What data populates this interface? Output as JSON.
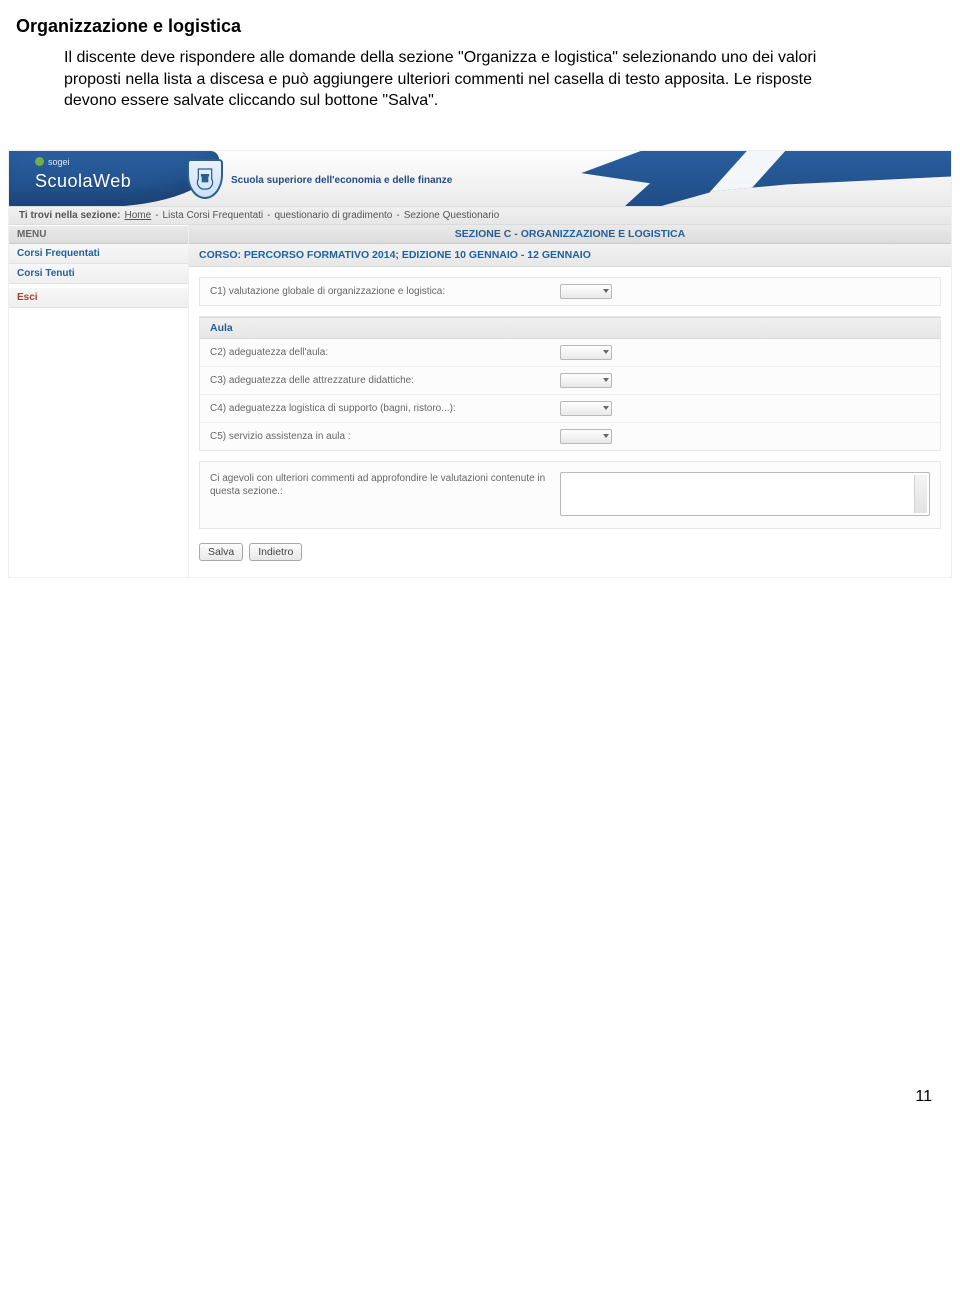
{
  "document": {
    "title": "Organizzazione e logistica",
    "paragraph": "Il discente deve rispondere alle domande della sezione \"Organizza e logistica\" selezionando uno dei valori proposti nella lista a discesa e può aggiungere ulteriori commenti nel casella di testo apposita.\nLe risposte devono essere salvate cliccando sul bottone \"Salva\"."
  },
  "banner": {
    "vendor": "sogei",
    "appname": "ScuolaWeb",
    "institute": "Scuola superiore dell'economia e delle finanze"
  },
  "breadcrumb": {
    "label": "Ti trovi nella sezione:",
    "items": [
      "Home",
      "Lista Corsi Frequentati",
      "questionario di gradimento",
      "Sezione Questionario"
    ]
  },
  "menu": {
    "heading": "MENU",
    "items": [
      {
        "label": "Corsi Frequentati",
        "red": false
      },
      {
        "label": "Corsi Tenuti",
        "red": false
      },
      {
        "label": "Esci",
        "red": true
      }
    ]
  },
  "main": {
    "section_title": "SEZIONE C - ORGANIZZAZIONE E LOGISTICA",
    "corso": "CORSO: PERCORSO FORMATIVO 2014; EDIZIONE 10 GENNAIO - 12 GENNAIO",
    "q1": "C1) valutazione globale di organizzazione e logistica:",
    "aula_heading": "Aula",
    "q2": "C2) adeguatezza dell'aula:",
    "q3": "C3) adeguatezza delle attrezzature didattiche:",
    "q4": "C4) adeguatezza logistica di supporto (bagni, ristoro...):",
    "q5": "C5) servizio assistenza in aula :",
    "comment_label": "Ci agevoli con ulteriori commenti ad approfondire le valutazioni contenute in questa sezione.:",
    "btn_save": "Salva",
    "btn_back": "Indietro"
  },
  "page_number": "11"
}
